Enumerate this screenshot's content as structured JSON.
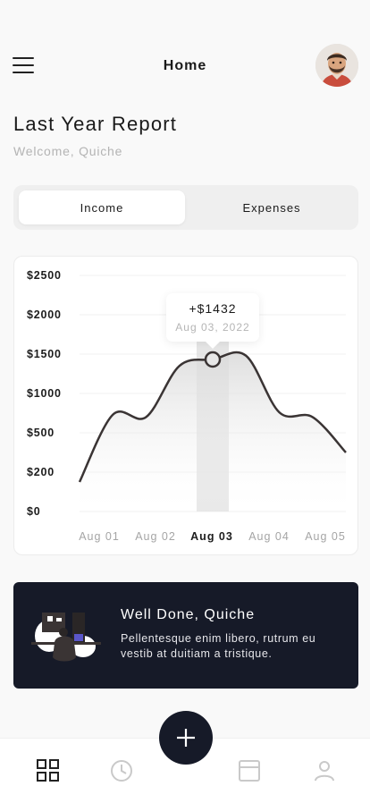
{
  "header": {
    "title": "Home"
  },
  "report": {
    "title": "Last Year Report",
    "welcome": "Welcome, Quiche"
  },
  "tabs": [
    {
      "label": "Income",
      "active": true
    },
    {
      "label": "Expenses",
      "active": false
    }
  ],
  "tooltip": {
    "value": "+$1432",
    "date": "Aug 03, 2022"
  },
  "chart_data": {
    "type": "area",
    "y_tick_labels": [
      "$2500",
      "$2000",
      "$1500",
      "$1000",
      "$500",
      "$200",
      "$0"
    ],
    "x_tick_labels": [
      "Aug 01",
      "Aug 02",
      "Aug 03",
      "Aug 04",
      "Aug 05"
    ],
    "highlighted_x": "Aug 03",
    "series": [
      {
        "x": [
          "Aug 01",
          "Aug 01.5",
          "Aug 02",
          "Aug 02.5",
          "Aug 03",
          "Aug 03.5",
          "Aug 04",
          "Aug 04.5",
          "Aug 05"
        ],
        "y": [
          150,
          730,
          700,
          1350,
          1432,
          1480,
          760,
          700,
          350
        ]
      }
    ],
    "grid": true,
    "line_color": "#3a3434",
    "highlight_band_color": "#dcdcdc"
  },
  "banner": {
    "title": "Well Done, Quiche",
    "text": "Pellentesque enim libero, rutrum eu vestib at duitiam a tristique."
  },
  "bottom_nav": {
    "items": [
      {
        "icon": "dashboard-grid-icon",
        "active": true
      },
      {
        "icon": "clock-icon",
        "active": false
      },
      {
        "icon": "add-icon",
        "active": false
      },
      {
        "icon": "card-icon",
        "active": false
      },
      {
        "icon": "profile-icon",
        "active": false
      }
    ]
  },
  "colors": {
    "dark": "#161a28",
    "muted_text": "#b4b4b4",
    "inactive_icon": "#c9c9c9"
  }
}
